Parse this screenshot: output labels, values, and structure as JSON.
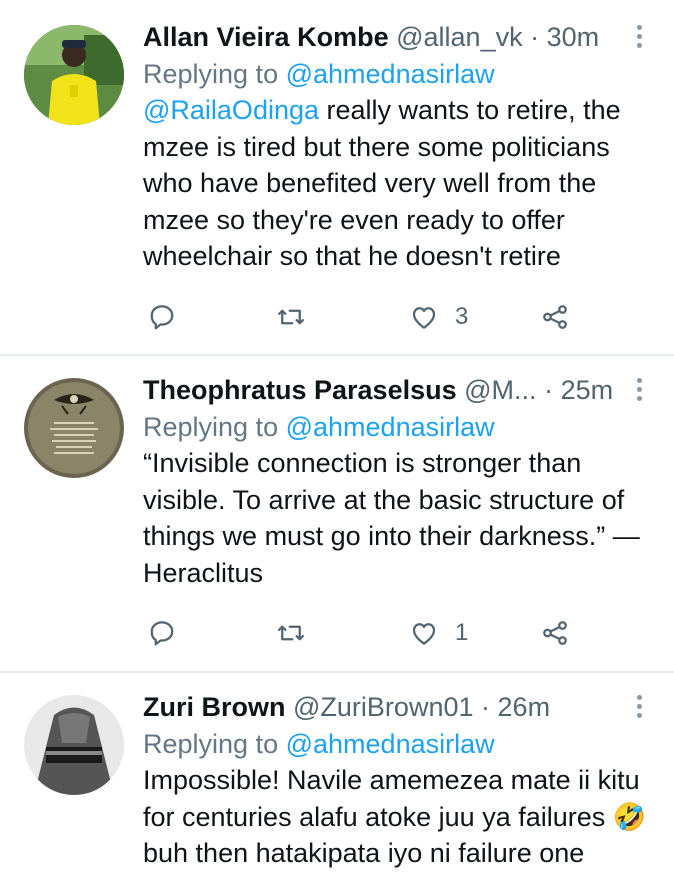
{
  "tweets": [
    {
      "name": "Allan Vieira Kombe",
      "handle": "@allan_vk",
      "dot": "·",
      "time": "30m",
      "reply_prefix": "Replying to",
      "reply_handle": "@ahmednasirlaw",
      "body_mention": "@RailaOdinga",
      "body_text": " really wants to retire, the mzee is tired but there some politicians who have benefited very well from the mzee so they're even ready to offer wheelchair so that he doesn't retire",
      "likes": "3",
      "avatar_icon": "person-yellow-shirt-avatar"
    },
    {
      "name": "Theophratus Paraselsus",
      "handle": "@M...",
      "dot": "·",
      "time": "25m",
      "reply_prefix": "Replying to",
      "reply_handle": "@ahmednasirlaw",
      "body_text": "“Invisible connection is stronger than visible. To arrive at the basic structure of things we must go into their darkness.” — Heraclitus",
      "likes": "1",
      "avatar_icon": "eye-of-horus-avatar"
    },
    {
      "name": "Zuri Brown",
      "handle": "@ZuriBrown01",
      "dot": "·",
      "time": "26m",
      "reply_prefix": "Replying to",
      "reply_handle": "@ahmednasirlaw",
      "body_text": "Impossible! Navile amemezea mate ii kitu for centuries alafu atoke juu ya failures 🤣buh then hatakipata iyo ni failure one",
      "avatar_icon": "grayscale-hand-avatar"
    }
  ],
  "colors": {
    "link": "#1da1f2",
    "secondary": "#536471",
    "divider": "#e6ecf0"
  }
}
